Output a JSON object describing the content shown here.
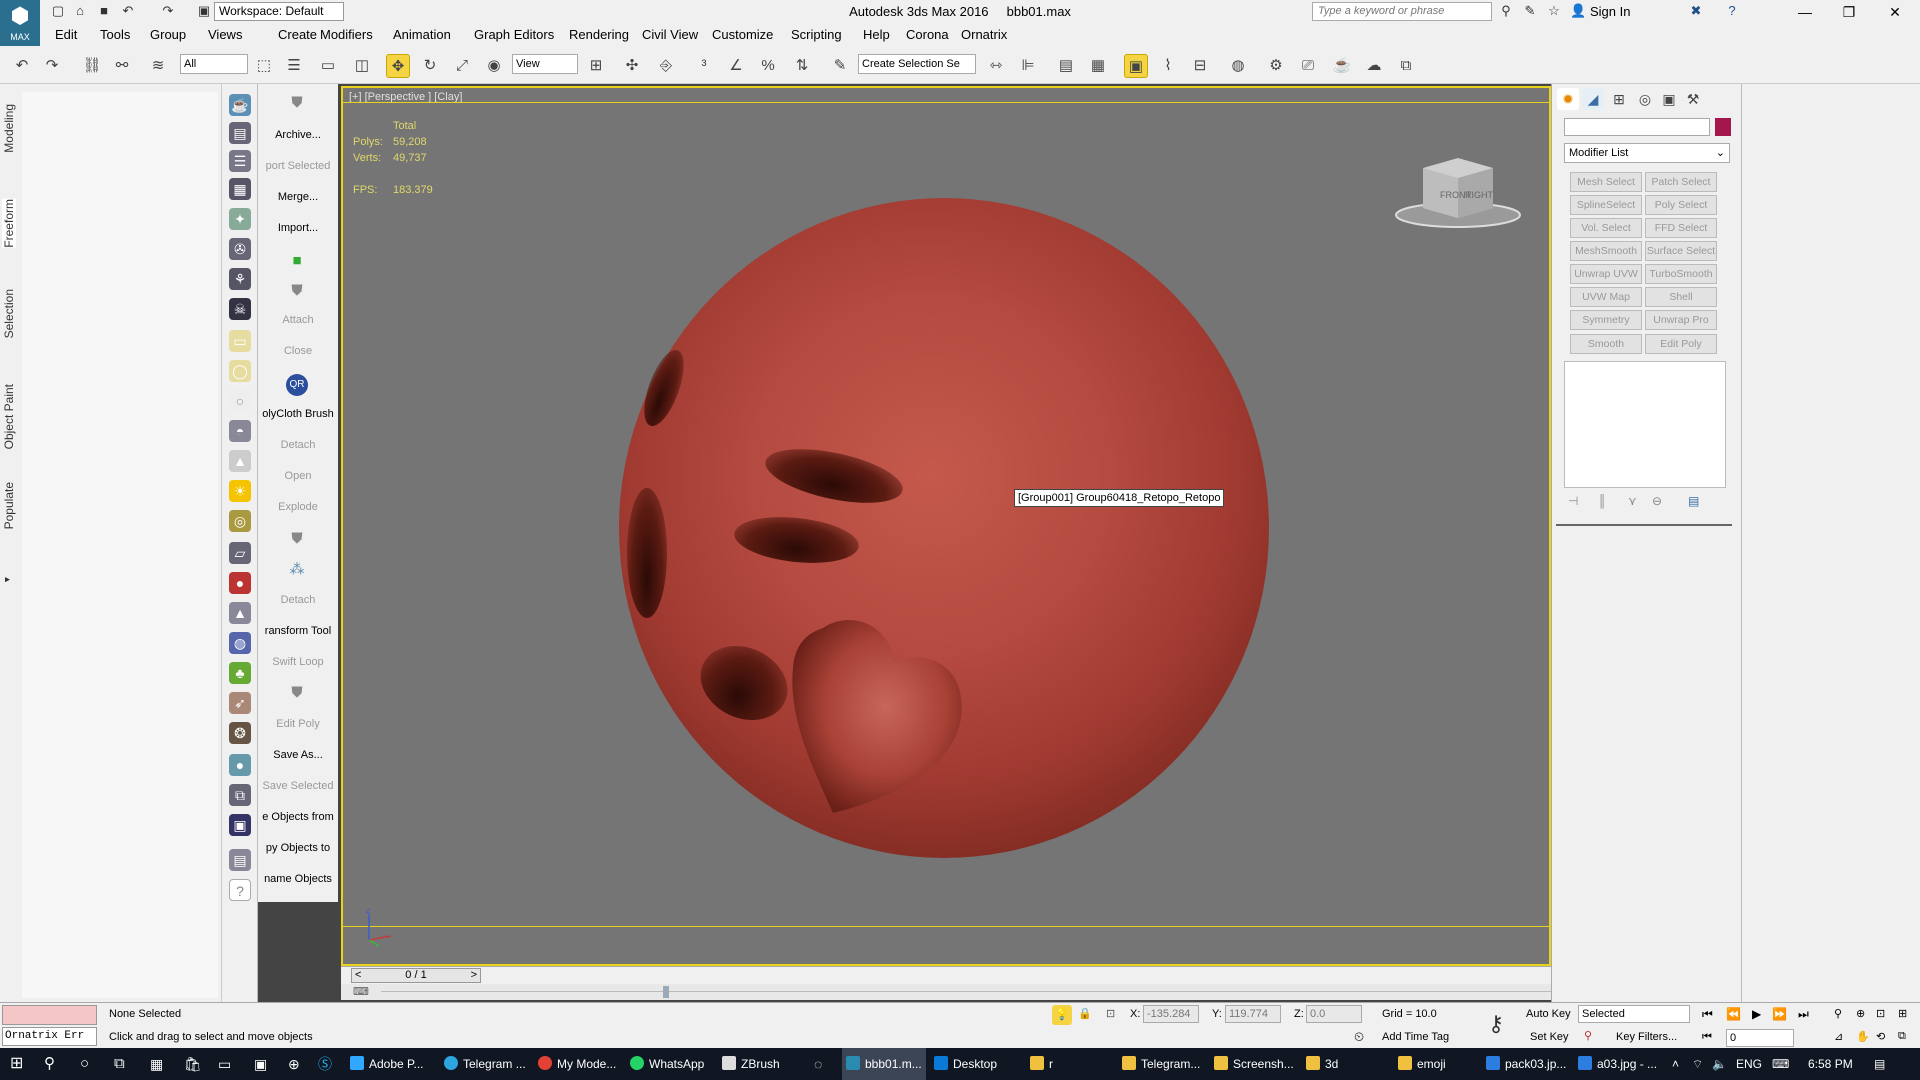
{
  "window": {
    "title": "Autodesk 3ds Max 2016",
    "filename": "bbb01.max",
    "workspace": "Workspace: Default",
    "search_placeholder": "Type a keyword or phrase",
    "sign_in": "Sign In",
    "logo": "MAX"
  },
  "menu": [
    "Edit",
    "Tools",
    "Group",
    "Views",
    "Create",
    "Modifiers",
    "Animation",
    "Graph Editors",
    "Rendering",
    "Civil View",
    "Customize",
    "Scripting",
    "Help",
    "Corona",
    "Ornatrix"
  ],
  "toolbar": {
    "selection_filter": "All",
    "ref_coord": "View",
    "named_selection": "Create Selection Se"
  },
  "left_tabs": [
    "Modeling",
    "Freeform",
    "Selection",
    "Object Paint",
    "Populate"
  ],
  "script_panel": [
    {
      "label": "Archive...",
      "dim": false
    },
    {
      "label": "port Selected",
      "dim": true
    },
    {
      "label": "Merge...",
      "dim": false
    },
    {
      "label": "Import...",
      "dim": false
    },
    {
      "label": "Attach",
      "dim": true
    },
    {
      "label": "Close",
      "dim": true
    },
    {
      "label": "olyCloth Brush",
      "dim": false
    },
    {
      "label": "Detach",
      "dim": true
    },
    {
      "label": "Open",
      "dim": true
    },
    {
      "label": "Explode",
      "dim": true
    },
    {
      "label": "Detach",
      "dim": true
    },
    {
      "label": "ransform Tool",
      "dim": false
    },
    {
      "label": "Swift Loop",
      "dim": true
    },
    {
      "label": "Edit Poly",
      "dim": true
    },
    {
      "label": "Save As...",
      "dim": false
    },
    {
      "label": "Save Selected",
      "dim": true
    },
    {
      "label": "e Objects from",
      "dim": false
    },
    {
      "label": "py Objects to",
      "dim": false
    },
    {
      "label": "name Objects",
      "dim": false
    }
  ],
  "viewport": {
    "label": "[+] [Perspective ] [Clay]",
    "stats": {
      "total_label": "Total",
      "polys_label": "Polys:",
      "polys": "59,208",
      "verts_label": "Verts:",
      "verts": "49,737",
      "fps_label": "FPS:",
      "fps": "183.379"
    },
    "tooltip": "[Group001] Group60418_Retopo_Retopo",
    "viewcube": {
      "front": "FRONT",
      "right": "RIGHT"
    },
    "axis_label": "Z",
    "frame_counter": "0 / 1",
    "colors": {
      "object": "#b44a40",
      "background": "#757575",
      "active_border": "#e8d21b"
    }
  },
  "command_panel": {
    "modifier_list": "Modifier List",
    "modifiers": [
      "Mesh Select",
      "Patch Select",
      "SplineSelect",
      "Poly Select",
      "Vol. Select",
      "FFD Select",
      "MeshSmooth",
      "Surface Select",
      "Unwrap UVW",
      "TurboSmooth",
      "UVW Map",
      "Shell",
      "Symmetry",
      "Unwrap Pro",
      "Smooth",
      "Edit Poly"
    ],
    "object_color": "#a3174c"
  },
  "status": {
    "script_error": "Ornatrix Err",
    "selection": "None Selected",
    "prompt": "Click and drag to select and move objects",
    "x_label": "X:",
    "x": "-135.284",
    "y_label": "Y:",
    "y": "119.774",
    "z_label": "Z:",
    "z": "0.0",
    "grid": "Grid = 10.0",
    "add_time_tag": "Add Time Tag",
    "auto_key": "Auto Key",
    "set_key": "Set Key",
    "key_mode": "Selected",
    "key_filters": "Key Filters...",
    "frame": "0"
  },
  "taskbar": {
    "items": [
      "Adobe P...",
      "Telegram ...",
      "My Mode...",
      "WhatsApp",
      "ZBrush",
      "bbb01.m...",
      "Desktop",
      "r",
      "Telegram...",
      "Screensh...",
      "3d",
      "emoji",
      "pack03.jp...",
      "a03.jpg - ..."
    ],
    "lang": "ENG",
    "time": "6:58 PM"
  }
}
